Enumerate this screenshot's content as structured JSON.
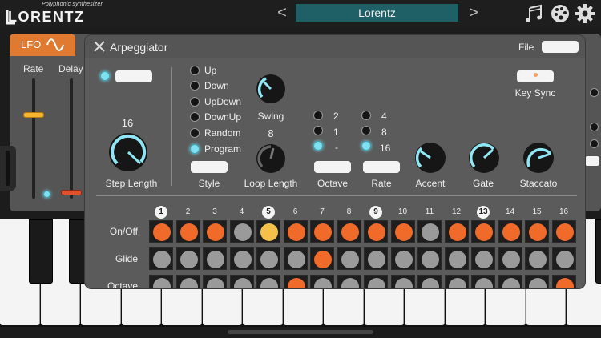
{
  "header": {
    "logo_tagline": "Polyphonic synthesizer",
    "logo_word": "LORENTZ",
    "preset_name": "Lorentz",
    "prev_glyph": "<",
    "next_glyph": ">",
    "icons": [
      "music-notes-icon",
      "palette-icon",
      "gear-icon"
    ]
  },
  "lfo": {
    "tab_label": "LFO",
    "rate_label": "Rate",
    "delay_label": "Delay",
    "rate_value": 0.7,
    "delay_value": 0.05
  },
  "arp": {
    "title": "Arpeggiator",
    "file_label": "File",
    "key_sync_label": "Key Sync",
    "step_length_value": "16",
    "step_length_label": "Step Length",
    "style_label": "Style",
    "style_options": [
      "Up",
      "Down",
      "UpDown",
      "DownUp",
      "Random",
      "Program"
    ],
    "style_selected": "Program",
    "swing_label": "Swing",
    "loop_length_value": "8",
    "loop_length_label": "Loop Length",
    "octave_label": "Octave",
    "octave_options": [
      "2",
      "1",
      "-"
    ],
    "octave_selected": "-",
    "rate_label": "Rate",
    "rate_options": [
      "4",
      "8",
      "16"
    ],
    "rate_selected": "16",
    "accent_label": "Accent",
    "gate_label": "Gate",
    "staccato_label": "Staccato"
  },
  "grid": {
    "steps": [
      "1",
      "2",
      "3",
      "4",
      "5",
      "6",
      "7",
      "8",
      "9",
      "10",
      "11",
      "12",
      "13",
      "14",
      "15",
      "16"
    ],
    "highlighted_steps": [
      "1",
      "5",
      "9",
      "13"
    ],
    "rows": [
      {
        "label": "On/Off",
        "cells": [
          "o",
          "o",
          "o",
          "g",
          "y",
          "o",
          "o",
          "o",
          "o",
          "o",
          "g",
          "o",
          "o",
          "o",
          "o",
          "o"
        ]
      },
      {
        "label": "Glide",
        "cells": [
          "g",
          "g",
          "g",
          "g",
          "g",
          "g",
          "o",
          "g",
          "g",
          "g",
          "g",
          "g",
          "g",
          "g",
          "g",
          "g"
        ]
      },
      {
        "label": "Octave",
        "cells": [
          "g",
          "g",
          "g",
          "g",
          "g",
          "o",
          "g",
          "g",
          "g",
          "g",
          "g",
          "g",
          "g",
          "g",
          "g",
          "o"
        ]
      }
    ]
  },
  "colors": {
    "orange": "#f06a2a",
    "yellow": "#f5c04a",
    "gray": "#9a9a9a",
    "accent_cyan": "#7fe0f0",
    "lfo_tab": "#e07a30",
    "preset_bg": "#1f5f66"
  }
}
